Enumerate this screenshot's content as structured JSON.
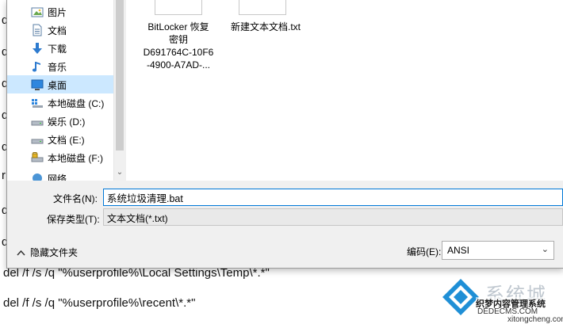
{
  "background": {
    "margin_chars": [
      "d",
      "d",
      "d",
      "d",
      "d",
      "r",
      "d",
      "d",
      "d",
      "d"
    ],
    "line1": "del /f /s /q \"%userprofile%\\Local Settings\\Temp\\*.*\"",
    "line2": "del /f /s /q \"%userprofile%\\recent\\*.*\""
  },
  "nav": {
    "items": [
      {
        "label": "图片",
        "icon": "pictures-icon"
      },
      {
        "label": "文档",
        "icon": "documents-icon"
      },
      {
        "label": "下载",
        "icon": "download-icon"
      },
      {
        "label": "音乐",
        "icon": "music-icon"
      },
      {
        "label": "桌面",
        "icon": "desktop-icon",
        "selected": true
      },
      {
        "label": "本地磁盘 (C:)",
        "icon": "windows-drive-icon"
      },
      {
        "label": "娱乐 (D:)",
        "icon": "drive-icon"
      },
      {
        "label": "文档 (E:)",
        "icon": "drive-icon"
      },
      {
        "label": "本地磁盘 (F:)",
        "icon": "locked-drive-icon"
      },
      {
        "label": "网络",
        "icon": "network-icon"
      }
    ]
  },
  "files": [
    {
      "name_lines": [
        "BitLocker 恢复",
        "密钥",
        "D691764C-10F6",
        "-4900-A7AD-..."
      ]
    },
    {
      "name_lines": [
        "新建文本文档.txt"
      ]
    }
  ],
  "form": {
    "filename_label": "文件名(N):",
    "filename_value": "系统垃圾清理.bat",
    "type_label": "保存类型(T):",
    "type_value": "文本文档(*.txt)",
    "hide_folders_label": "隐藏文件夹",
    "encoding_label": "编码(E):",
    "encoding_value": "ANSI"
  },
  "watermark": {
    "title": "系统城",
    "subtitle": "织梦内容管理系统",
    "url1": "DEDECMS.COM",
    "url2": "xitongcheng.com"
  }
}
